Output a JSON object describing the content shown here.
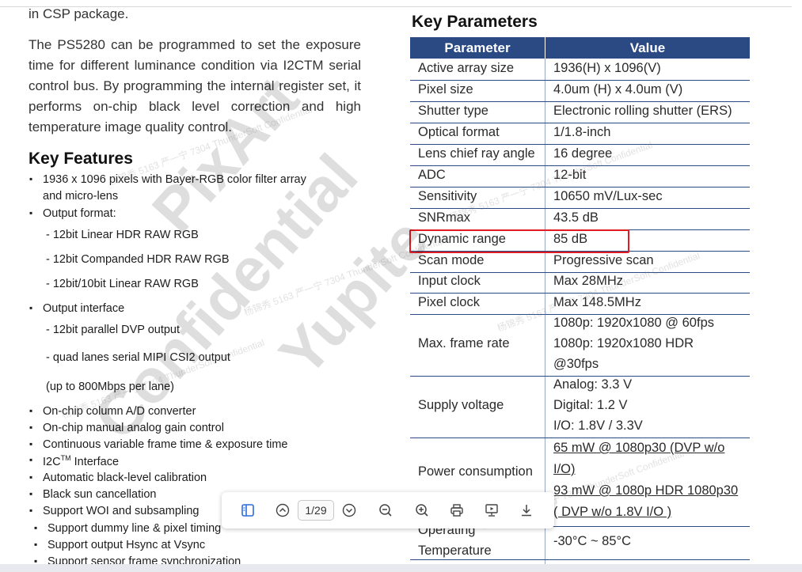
{
  "left": {
    "intro_line": "in CSP package.",
    "paragraph": "The PS5280 can be programmed to set the exposure time for different luminance condition via I2CTM serial control bus. By programming the internal register set, it performs on-chip black level correction and high temperature image quality control.",
    "features_heading": "Key Features",
    "features": [
      "1936 x 1096 pixels with Bayer-RGB color filter array",
      "and micro-lens",
      "Output format:",
      "- 12bit Linear HDR RAW RGB",
      "- 12bit Companded HDR RAW RGB",
      "- 12bit/10bit Linear RAW RGB",
      "Output interface",
      "- 12bit parallel DVP output",
      "- quad lanes serial MIPI CSI2 output",
      "(up to 800Mbps per lane)",
      "On-chip column A/D converter",
      "On-chip manual analog gain control",
      "Continuous variable frame time & exposure time",
      "I2C",
      "Automatic black-level calibration",
      "Black sun cancellation",
      "Support WOI and subsampling",
      "Support dummy line & pixel timing",
      "Support output Hsync at Vsync",
      "Support sensor frame synchronization"
    ],
    "i2c_superscript": "TM",
    "i2c_suffix": " Interface"
  },
  "parameters": {
    "heading": "Key Parameters",
    "col_param": "Parameter",
    "col_value": "Value",
    "rows": [
      {
        "param": "Active array size",
        "value": [
          "1936(H) x 1096(V)"
        ]
      },
      {
        "param": "Pixel size",
        "value": [
          "4.0um (H) x 4.0um (V)"
        ]
      },
      {
        "param": "Shutter type",
        "value": [
          "Electronic rolling shutter (ERS)"
        ]
      },
      {
        "param": "Optical format",
        "value": [
          "1/1.8-inch"
        ]
      },
      {
        "param": "Lens chief ray angle",
        "value": [
          "16 degree"
        ]
      },
      {
        "param": "ADC",
        "value": [
          "12-bit"
        ]
      },
      {
        "param": "Sensitivity",
        "value": [
          "10650 mV/Lux-sec"
        ]
      },
      {
        "param": "SNRmax",
        "value": [
          "43.5 dB"
        ]
      },
      {
        "param": "Dynamic range",
        "value": [
          "85 dB"
        ]
      },
      {
        "param": "Scan mode",
        "value": [
          "Progressive scan"
        ]
      },
      {
        "param": "Input clock",
        "value": [
          "Max 28MHz"
        ]
      },
      {
        "param": "Pixel clock",
        "value": [
          "Max 148.5MHz"
        ]
      },
      {
        "param": "Max. frame rate",
        "value": [
          "1080p: 1920x1080 @ 60fps",
          "1080p: 1920x1080 HDR",
          "@30fps"
        ]
      },
      {
        "param": "Supply voltage",
        "value": [
          "Analog: 3.3 V",
          "Digital: 1.2 V",
          "I/O: 1.8V / 3.3V"
        ]
      },
      {
        "param": "Power consumption",
        "value": [
          "65 mW @ 1080p30 (DVP w/o",
          "I/O)",
          "93 mW @ 1080p HDR 1080p30",
          "( DVP w/o 1.8V I/O )"
        ]
      },
      {
        "param": "Operating Temperature",
        "value": [
          "-30°C ~ 85°C"
        ]
      }
    ]
  },
  "watermark": {
    "big": [
      "PixArt",
      "Confidential",
      "Yupite"
    ],
    "small": "杨锦秀 5163  严一宁 7304 ThunderSoft Confidential"
  },
  "toolbar": {
    "page_indicator": "1/29",
    "icons": [
      "sidebar-icon",
      "page-up-icon",
      "page-down-icon",
      "zoom-out-icon",
      "zoom-in-icon",
      "print-icon",
      "present-icon",
      "download-icon"
    ]
  },
  "highlight_color": "#e11b22",
  "header_color": "#2b4a83"
}
